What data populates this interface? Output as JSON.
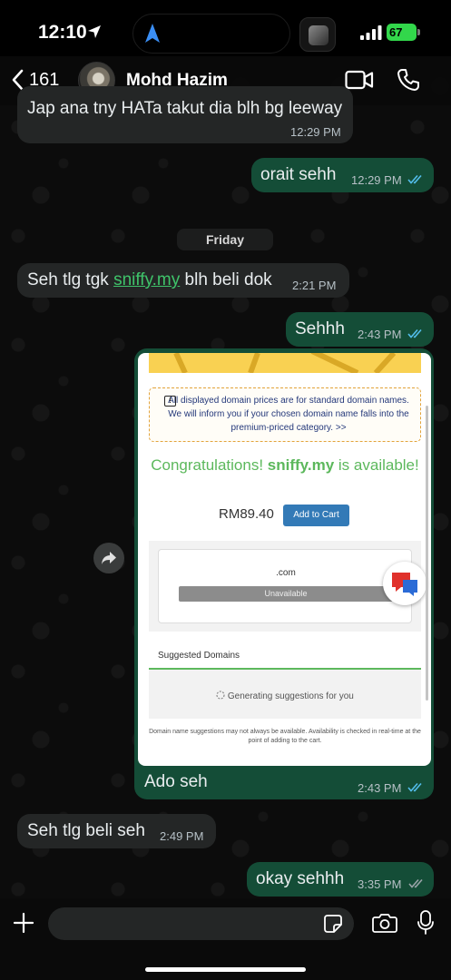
{
  "status_bar": {
    "time": "12:10",
    "battery": "67"
  },
  "header": {
    "back_count": "161",
    "contact_name": "Mohd Hazim"
  },
  "messages": {
    "m1": {
      "text": "Jap ana tny HATa takut dia blh bg leeway",
      "time": "12:29 PM"
    },
    "m2": {
      "text": "orait sehh",
      "time": "12:29 PM"
    },
    "date_divider": "Friday",
    "m3": {
      "text_before": "Seh tlg tgk ",
      "link": "sniffy.my",
      "text_after": " blh beli dok",
      "time": "2:21 PM"
    },
    "m4": {
      "text": "Sehhh",
      "time": "2:43 PM"
    },
    "m5": {
      "caption": "Ado seh",
      "time": "2:43 PM"
    },
    "m6": {
      "text": "Seh tlg beli seh",
      "time": "2:49 PM"
    },
    "m7": {
      "text": "okay sehhh",
      "time": "3:35 PM"
    }
  },
  "screenshot": {
    "notice": "All displayed domain prices are for standard domain names. We will inform you if your chosen domain name falls into the premium-priced category. >>",
    "congrats_prefix": "Congratulations!",
    "congrats_domain": "sniffy.my",
    "congrats_suffix": "is available!",
    "price": "RM89.40",
    "add_to_cart": "Add to Cart",
    "tld": ".com",
    "unavailable": "Unavailable",
    "suggested_title": "Suggested Domains",
    "generating": "Generating suggestions for you",
    "disclaimer": "Domain name suggestions may not always be available. Availability is checked in real-time at the point of adding to the cart."
  },
  "input": {
    "placeholder": ""
  },
  "colors": {
    "outgoing_bubble": "#144d37",
    "incoming_bubble": "#242626",
    "read_ticks": "#53bdeb",
    "link": "#3fc36a"
  }
}
